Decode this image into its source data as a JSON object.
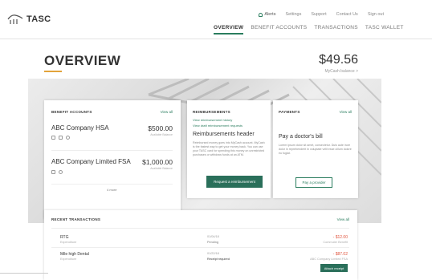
{
  "logo": {
    "text": "TASC"
  },
  "util_nav": {
    "alerts": "Alerts",
    "settings": "Settings",
    "support": "Support",
    "contact": "Contact Us",
    "signout": "Sign out"
  },
  "main_nav": {
    "overview": "OVERVIEW",
    "benefit_accounts": "BENEFIT ACCOUNTS",
    "transactions": "TRANSACTIONS",
    "wallet": "TASC WALLET"
  },
  "page": {
    "title": "OVERVIEW",
    "balance": "$49.56",
    "balance_label": "MyCash balance >"
  },
  "benefits": {
    "heading": "BENEFIT ACCOUNTS",
    "view_all": "View all",
    "accounts": [
      {
        "name": "ABC Company HSA",
        "amount": "$500.00",
        "sub": "Available Balance"
      },
      {
        "name": "ABC Company Limited FSA",
        "amount": "$1,000.00",
        "sub": "Available Balance"
      }
    ],
    "more": "4 more"
  },
  "reimbursements": {
    "heading": "REIMBURSEMENTS",
    "link1": "View reimbursement history",
    "link2": "View draft reimbursement requests",
    "header": "Reimbursements header",
    "body": "Reimbursed money goes into MyCash account. MyCash is the fastest way to get your money back. You can use your TASC card for spending this money on unrestricted purchases or withdraw funds at an ATM.",
    "button": "Request a reimbursement"
  },
  "payments": {
    "heading": "PAYMENTS",
    "view_all": "View all",
    "title": "Pay a doctor's bill",
    "body": "Lorem ipsum dolor sit amet, consectetur. Duis aute irure dolor in reprehenderit in voluptate velit esse cillum dolore eu fugiat.",
    "button": "Pay a provider"
  },
  "transactions": {
    "heading": "RECENT TRANSACTIONS",
    "view_all": "View all",
    "rows": [
      {
        "name": "RTG",
        "type": "Expenditure",
        "date": "01/04/18",
        "status": "Pending",
        "amount": "- $12.00",
        "account": "Commuter Benefit"
      },
      {
        "name": "Mile high Dental",
        "type": "Expenditure",
        "date": "01/22/18",
        "status": "Receipt required",
        "amount": "- $87.02",
        "account": "ABC Company Limited FSA",
        "action": "Attach receipt"
      }
    ]
  },
  "colors": {
    "accent": "#2a7d5e",
    "button": "#2a6f5a",
    "highlight": "#e2a33a",
    "negative": "#e0533c"
  }
}
